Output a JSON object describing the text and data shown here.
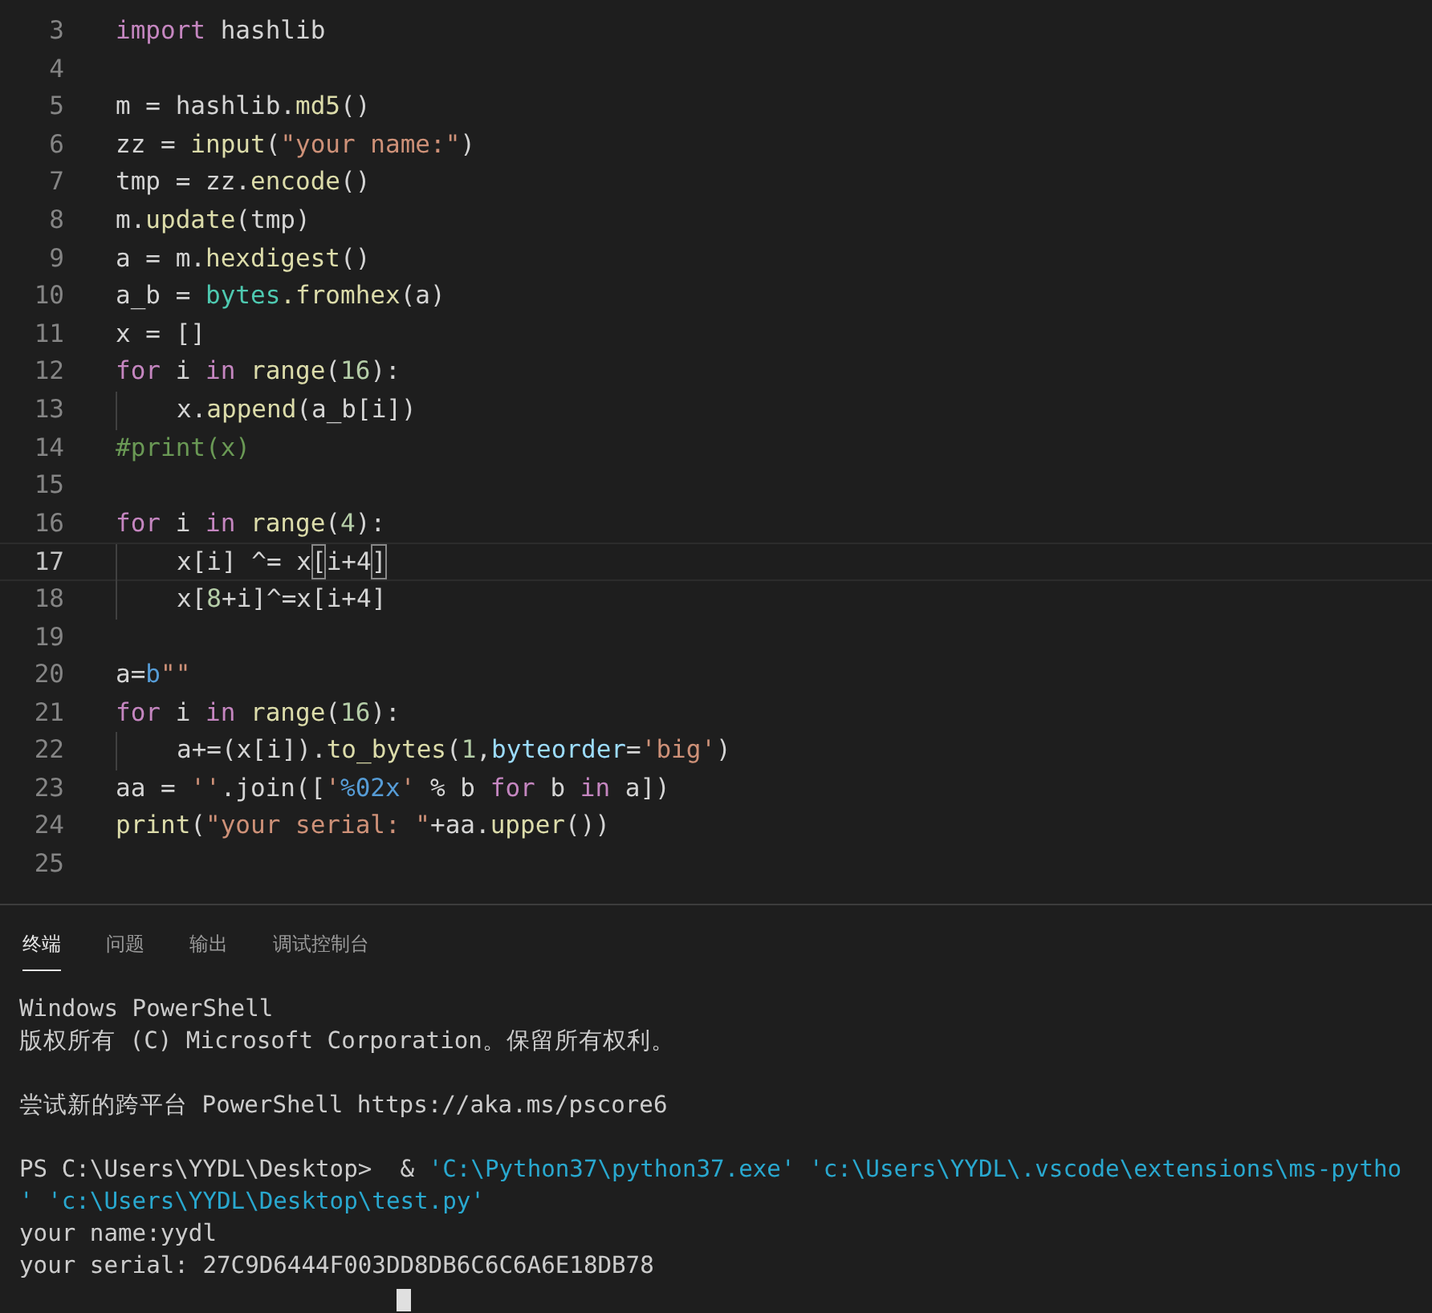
{
  "editor": {
    "lines": [
      {
        "number": "3",
        "current": false,
        "indent": false,
        "tokens": [
          {
            "text": "import",
            "kind": "keyword"
          },
          {
            "text": " hashlib",
            "kind": "plain"
          }
        ]
      },
      {
        "number": "4",
        "current": false
      },
      {
        "number": "5",
        "current": false,
        "indent": false,
        "tokens": [
          {
            "text": "m = hashlib.",
            "kind": "plain"
          },
          {
            "text": "md5",
            "kind": "function"
          },
          {
            "text": "()",
            "kind": "plain"
          }
        ]
      },
      {
        "number": "6",
        "current": false,
        "indent": false,
        "tokens": [
          {
            "text": "zz = ",
            "kind": "plain"
          },
          {
            "text": "input",
            "kind": "function"
          },
          {
            "text": "(",
            "kind": "plain"
          },
          {
            "text": "\"your name:\"",
            "kind": "string"
          },
          {
            "text": ")",
            "kind": "plain"
          }
        ]
      },
      {
        "number": "7",
        "current": false,
        "indent": false,
        "tokens": [
          {
            "text": "tmp = zz.",
            "kind": "plain"
          },
          {
            "text": "encode",
            "kind": "function"
          },
          {
            "text": "()",
            "kind": "plain"
          }
        ]
      },
      {
        "number": "8",
        "current": false,
        "indent": false,
        "tokens": [
          {
            "text": "m.",
            "kind": "plain"
          },
          {
            "text": "update",
            "kind": "function"
          },
          {
            "text": "(tmp)",
            "kind": "plain"
          }
        ]
      },
      {
        "number": "9",
        "current": false,
        "indent": false,
        "tokens": [
          {
            "text": "a = m.",
            "kind": "plain"
          },
          {
            "text": "hexdigest",
            "kind": "function"
          },
          {
            "text": "()",
            "kind": "plain"
          }
        ]
      },
      {
        "number": "10",
        "current": false,
        "indent": false,
        "tokens": [
          {
            "text": "a_b = ",
            "kind": "plain"
          },
          {
            "text": "bytes",
            "kind": "class"
          },
          {
            "text": ".fromhex",
            "kind": "function"
          },
          {
            "text": "(a)",
            "kind": "plain"
          }
        ]
      },
      {
        "number": "11",
        "current": false,
        "indent": false,
        "tokens": [
          {
            "text": "x = []",
            "kind": "plain"
          }
        ]
      },
      {
        "number": "12",
        "current": false,
        "indent": false,
        "tokens": [
          {
            "text": "for",
            "kind": "keyword"
          },
          {
            "text": " i ",
            "kind": "plain"
          },
          {
            "text": "in ",
            "kind": "keyword"
          },
          {
            "text": "range",
            "kind": "function"
          },
          {
            "text": "(",
            "kind": "plain"
          },
          {
            "text": "16",
            "kind": "number"
          },
          {
            "text": "):",
            "kind": "plain"
          }
        ]
      },
      {
        "number": "13",
        "current": false,
        "indent": true,
        "tokens": [
          {
            "text": "x.",
            "kind": "plain"
          },
          {
            "text": "append",
            "kind": "function"
          },
          {
            "text": "(a_b[i])",
            "kind": "plain"
          }
        ]
      },
      {
        "number": "14",
        "current": false,
        "indent": false,
        "tokens": [
          {
            "text": "#print(x)",
            "kind": "comment"
          }
        ]
      },
      {
        "number": "15",
        "current": false
      },
      {
        "number": "16",
        "current": false,
        "indent": false,
        "tokens": [
          {
            "text": "for",
            "kind": "keyword"
          },
          {
            "text": " i ",
            "kind": "plain"
          },
          {
            "text": "in ",
            "kind": "keyword"
          },
          {
            "text": "range",
            "kind": "function"
          },
          {
            "text": "(",
            "kind": "plain"
          },
          {
            "text": "4",
            "kind": "number"
          },
          {
            "text": "):",
            "kind": "plain"
          }
        ]
      },
      {
        "number": "17",
        "current": true,
        "indent": true,
        "tokens": [
          {
            "text": "x[i] ^= x",
            "kind": "plain"
          },
          {
            "text": "[",
            "kind": "bracket_match"
          },
          {
            "text": "i+4",
            "kind": "plain"
          },
          {
            "text": "]",
            "kind": "bracket_match"
          }
        ]
      },
      {
        "number": "18",
        "current": false,
        "indent": true,
        "tokens": [
          {
            "text": "x[",
            "kind": "plain"
          },
          {
            "text": "8",
            "kind": "number"
          },
          {
            "text": "+i]^=x[i+4]",
            "kind": "plain"
          }
        ]
      },
      {
        "number": "19",
        "current": false
      },
      {
        "number": "20",
        "current": false,
        "indent": false,
        "tokens": [
          {
            "text": "a=",
            "kind": "plain"
          },
          {
            "text": "b",
            "kind": "storage"
          },
          {
            "text": "\"\"",
            "kind": "string"
          }
        ]
      },
      {
        "number": "21",
        "current": false,
        "indent": false,
        "tokens": [
          {
            "text": "for",
            "kind": "keyword"
          },
          {
            "text": " i ",
            "kind": "plain"
          },
          {
            "text": "in ",
            "kind": "keyword"
          },
          {
            "text": "range",
            "kind": "function"
          },
          {
            "text": "(",
            "kind": "plain"
          },
          {
            "text": "16",
            "kind": "number"
          },
          {
            "text": "):",
            "kind": "plain"
          }
        ]
      },
      {
        "number": "22",
        "current": false,
        "indent": true,
        "tokens": [
          {
            "text": "a+=(x[i]).",
            "kind": "plain"
          },
          {
            "text": "to_bytes",
            "kind": "function"
          },
          {
            "text": "(",
            "kind": "plain"
          },
          {
            "text": "1",
            "kind": "number"
          },
          {
            "text": ",",
            "kind": "plain"
          },
          {
            "text": "byteorder",
            "kind": "parameter"
          },
          {
            "text": "=",
            "kind": "plain"
          },
          {
            "text": "'big'",
            "kind": "string"
          },
          {
            "text": ")",
            "kind": "plain"
          }
        ]
      },
      {
        "number": "23",
        "current": false,
        "indent": false,
        "tokens": [
          {
            "text": "aa = ",
            "kind": "plain"
          },
          {
            "text": "''",
            "kind": "string"
          },
          {
            "text": ".join([",
            "kind": "plain"
          },
          {
            "text": "'",
            "kind": "string"
          },
          {
            "text": "%02x",
            "kind": "storage"
          },
          {
            "text": "'",
            "kind": "string"
          },
          {
            "text": " % b ",
            "kind": "plain"
          },
          {
            "text": "for",
            "kind": "keyword"
          },
          {
            "text": " b ",
            "kind": "plain"
          },
          {
            "text": "in",
            "kind": "keyword"
          },
          {
            "text": " a])",
            "kind": "plain"
          }
        ]
      },
      {
        "number": "24",
        "current": false,
        "indent": false,
        "tokens": [
          {
            "text": "print",
            "kind": "function"
          },
          {
            "text": "(",
            "kind": "plain"
          },
          {
            "text": "\"your serial: \"",
            "kind": "string"
          },
          {
            "text": "+aa.",
            "kind": "plain"
          },
          {
            "text": "upper",
            "kind": "function"
          },
          {
            "text": "())",
            "kind": "plain"
          }
        ]
      },
      {
        "number": "25",
        "current": false
      }
    ]
  },
  "panel": {
    "tabs": [
      {
        "label": "终端",
        "selected": true
      },
      {
        "label": "问题",
        "selected": false
      },
      {
        "label": "输出",
        "selected": false
      },
      {
        "label": "调试控制台",
        "selected": false
      }
    ],
    "terminal": {
      "blocks": [
        [
          [
            {
              "text": "Windows PowerShell",
              "kind": "plain"
            }
          ],
          [
            {
              "text": "版权所有 (C) Microsoft Corporation。保留所有权利。",
              "kind": "plain"
            }
          ]
        ],
        [
          [
            {
              "text": "尝试新的跨平台 PowerShell https://aka.ms/pscore6",
              "kind": "plain"
            }
          ]
        ],
        [
          [
            {
              "text": "PS C:\\Users\\YYDL\\Desktop>  & ",
              "kind": "plain"
            },
            {
              "text": "'C:\\Python37\\python37.exe' 'c:\\Users\\YYDL\\.vscode\\extensions\\ms-pytho",
              "kind": "string"
            }
          ],
          [
            {
              "text": "' 'c:\\Users\\YYDL\\Desktop\\test.py'",
              "kind": "string"
            }
          ],
          [
            {
              "text": "your name:yydl",
              "kind": "plain"
            }
          ],
          [
            {
              "text": "your serial: 27C9D6444F003DD8DB6C6C6A6E18DB78",
              "kind": "plain"
            }
          ]
        ]
      ]
    }
  }
}
